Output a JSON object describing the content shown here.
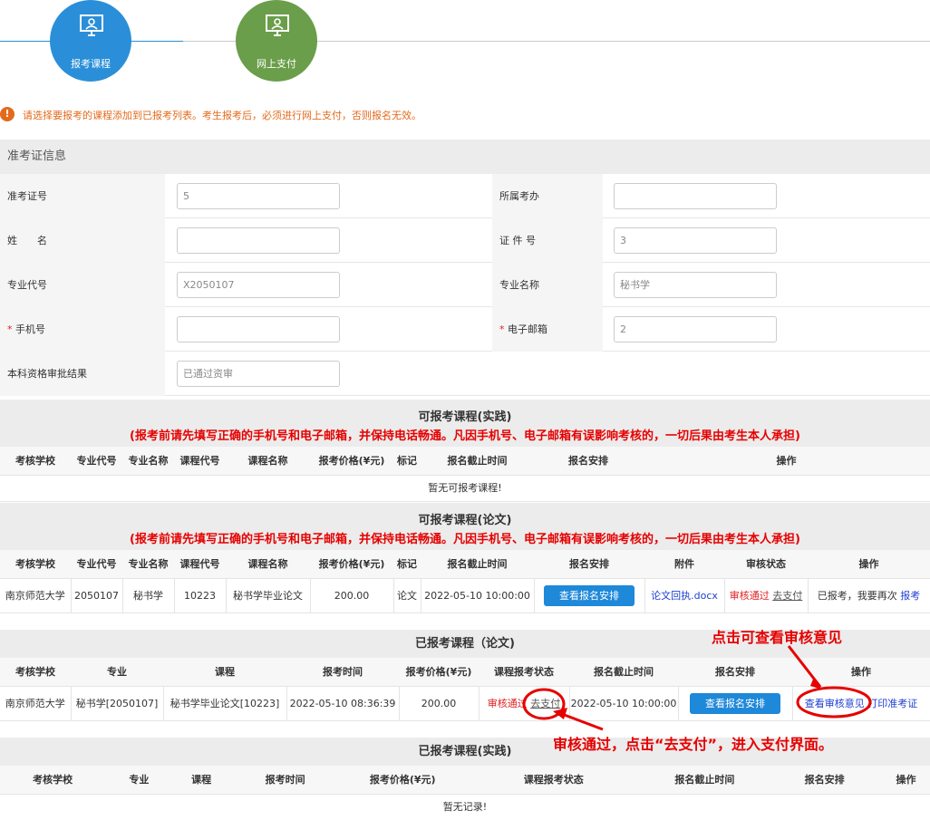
{
  "steps": [
    {
      "label": "报考课程",
      "color": "#2a8fd8"
    },
    {
      "label": "网上支付",
      "color": "#6a9e4a"
    }
  ],
  "notice": "请选择要报考的课程添加到已报考列表。考生报考后，必须进行网上支付，否则报名无效。",
  "info": {
    "title": "准考证信息",
    "fields": {
      "admission_no": {
        "label": "准考证号",
        "value": "5"
      },
      "office": {
        "label": "所属考办",
        "value": ""
      },
      "name": {
        "label": "姓　　名",
        "value": ""
      },
      "id_no": {
        "label": "证 件 号",
        "value": "3"
      },
      "major_code": {
        "label": "专业代号",
        "value": "X2050107"
      },
      "major_name": {
        "label": "专业名称",
        "value": "秘书学"
      },
      "phone": {
        "label": "手机号",
        "req": "*",
        "value": ""
      },
      "email": {
        "label": "电子邮箱",
        "req": "*",
        "value": "2"
      },
      "review": {
        "label": "本科资格审批结果",
        "value": "已通过资审"
      }
    }
  },
  "practice": {
    "title": "可报考课程(实践)",
    "warning": "(报考前请先填写正确的手机号和电子邮箱，并保持电话畅通。凡因手机号、电子邮箱有误影响考核的，一切后果由考生本人承担)",
    "headers": [
      "考核学校",
      "专业代号",
      "专业名称",
      "课程代号",
      "课程名称",
      "报考价格(¥元)",
      "标记",
      "报名截止时间",
      "报名安排",
      "操作"
    ],
    "empty": "暂无可报考课程!"
  },
  "thesis": {
    "title": "可报考课程(论文)",
    "warning": "(报考前请先填写正确的手机号和电子邮箱，并保持电话畅通。凡因手机号、电子邮箱有误影响考核的，一切后果由考生本人承担)",
    "headers": [
      "考核学校",
      "专业代号",
      "专业名称",
      "课程代号",
      "课程名称",
      "报考价格(¥元)",
      "标记",
      "报名截止时间",
      "报名安排",
      "附件",
      "审核状态",
      "操作"
    ],
    "row": {
      "school": "南京师范大学",
      "code": "2050107",
      "major": "秘书学",
      "course_code": "10223",
      "course": "秘书学毕业论文",
      "price": "200.00",
      "mark": "论文",
      "deadline": "2022-05-10 10:00:00",
      "arrange": "查看报名安排",
      "attach": "论文回执.docx",
      "status": "审核通过",
      "pay": "去支付",
      "op_text": "已报考，我要再次",
      "op_link": "报考"
    }
  },
  "registered_thesis": {
    "title": "已报考课程（论文)",
    "headers": [
      "考核学校",
      "专业",
      "课程",
      "报考时间",
      "报考价格(¥元)",
      "课程报考状态",
      "报名截止时间",
      "报名安排",
      "操作"
    ],
    "row": {
      "school": "南京师范大学",
      "major": "秘书学[2050107]",
      "course": "秘书学毕业论文[10223]",
      "time": "2022-05-10 08:36:39",
      "price": "200.00",
      "status": "审核通过",
      "pay": "去支付",
      "deadline": "2022-05-10 10:00:00",
      "arrange": "查看报名安排",
      "view": "查看审核意见",
      "print": "打印准考证"
    }
  },
  "registered_practice": {
    "title": "已报考课程(实践)",
    "headers": [
      "考核学校",
      "专业",
      "课程",
      "报考时间",
      "报考价格(¥元)",
      "课程报考状态",
      "报名截止时间",
      "报名安排",
      "操作"
    ],
    "empty": "暂无记录!"
  },
  "annotations": {
    "top": "点击可查看审核意见",
    "bottom": "审核通过，点击“去支付”，进入支付界面。"
  }
}
